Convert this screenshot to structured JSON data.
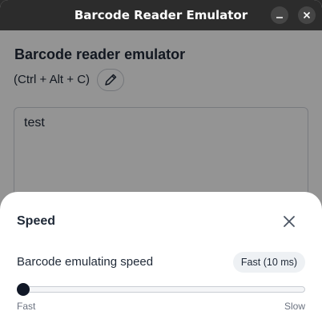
{
  "window": {
    "title": "Barcode Reader Emulator",
    "minimize_icon": "minimize-icon",
    "close_icon": "close-icon"
  },
  "app": {
    "heading": "Barcode reader emulator",
    "shortcut": "(Ctrl + Alt + C)",
    "edit_icon": "pencil-icon",
    "input_text": "test"
  },
  "speed_sheet": {
    "title": "Speed",
    "close_icon": "close-icon",
    "label": "Barcode emulating speed",
    "badge": "Fast (10 ms)",
    "slider": {
      "value_fraction": 0.0,
      "min_label": "Fast",
      "max_label": "Slow"
    }
  },
  "colors": {
    "titlebar": "#2c2c2c",
    "overlay": "rgba(0,0,0,0.42)",
    "thumb": "#111827",
    "badge_bg": "#eef1f4"
  }
}
